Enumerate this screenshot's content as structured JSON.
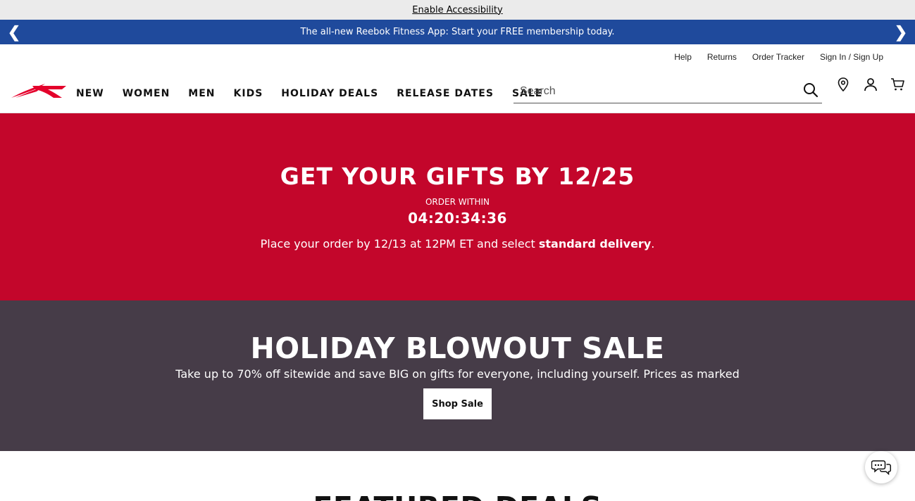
{
  "accessibility": {
    "link_label": "Enable Accessibility"
  },
  "promo": {
    "text": "The all-new Reebok Fitness App: Start your FREE membership today.",
    "prev_icon": "chevron-left-icon",
    "next_icon": "chevron-right-icon",
    "prev_glyph": "❮",
    "next_glyph": "❯",
    "background": "#1f4a9c"
  },
  "utility_links": [
    "Help",
    "Returns",
    "Order Tracker",
    "Sign In / Sign Up"
  ],
  "nav": {
    "logo": "reebok-logo",
    "items": [
      "NEW",
      "WOMEN",
      "MEN",
      "KIDS",
      "HOLIDAY DEALS",
      "RELEASE DATES",
      "SALE"
    ]
  },
  "search": {
    "placeholder": "Search",
    "value": "",
    "icon": "search-icon"
  },
  "header_icons": [
    "location-pin-icon",
    "account-icon",
    "cart-icon"
  ],
  "gifts_banner": {
    "title": "GET YOUR GIFTS BY 12/25",
    "order_label": "ORDER WITHIN",
    "countdown": "04:20:34:36",
    "note_prefix": "Place your order by 12/13 at 12PM ET and select ",
    "note_bold": "standard delivery",
    "note_suffix": ".",
    "background": "#c3062b"
  },
  "blowout_banner": {
    "title": "HOLIDAY BLOWOUT SALE",
    "subtitle": "Take up to 70% off sitewide and save BIG on gifts for everyone, including yourself. Prices as marked",
    "button_label": "Shop Sale",
    "background": "#463c48"
  },
  "featured": {
    "title": "FEATURED DEALS"
  },
  "chat": {
    "icon": "chat-bubbles-icon"
  },
  "colors": {
    "brand_red": "#e4002b"
  }
}
